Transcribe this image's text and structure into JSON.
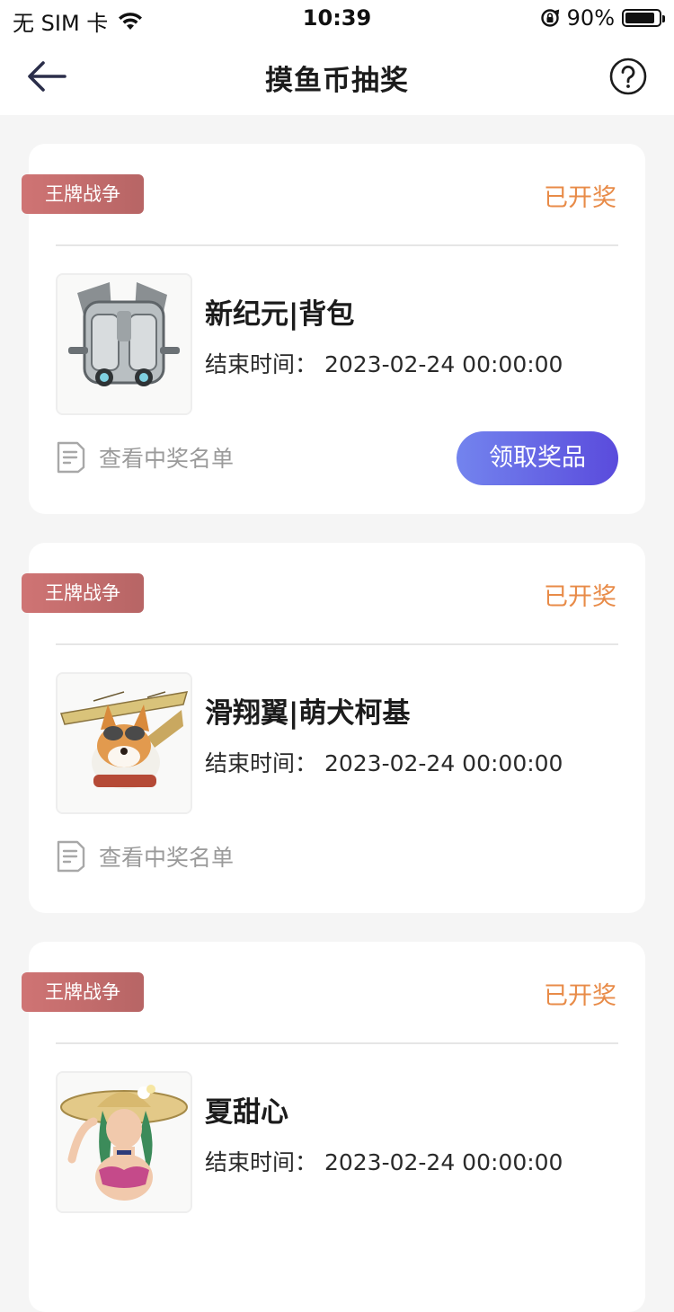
{
  "status_bar": {
    "carrier": "无 SIM 卡",
    "time": "10:39",
    "battery_percent": "90%",
    "battery_level": 0.9
  },
  "nav": {
    "title": "摸鱼币抽奖",
    "back_icon": "arrow-left-icon",
    "help_icon": "question-circle-icon"
  },
  "colors": {
    "tag": "#c46c6c",
    "status": "#e88b48",
    "button_start": "#7384ee",
    "button_end": "#5a4bdc"
  },
  "cards": [
    {
      "tag": "王牌战争",
      "status": "已开奖",
      "name": "新纪元|背包",
      "end_time": "结束时间：  2023-02-24 00:00:00",
      "winners_link": "查看中奖名单",
      "claim_label": "领取奖品",
      "image": "backpack"
    },
    {
      "tag": "王牌战争",
      "status": "已开奖",
      "name": "滑翔翼|萌犬柯基",
      "end_time": "结束时间：  2023-02-24 00:00:00",
      "winners_link": "查看中奖名单",
      "image": "corgi-glider"
    },
    {
      "tag": "王牌战争",
      "status": "已开奖",
      "name": "夏甜心",
      "end_time": "结束时间：  2023-02-24 00:00:00",
      "image": "summer-girl"
    }
  ]
}
